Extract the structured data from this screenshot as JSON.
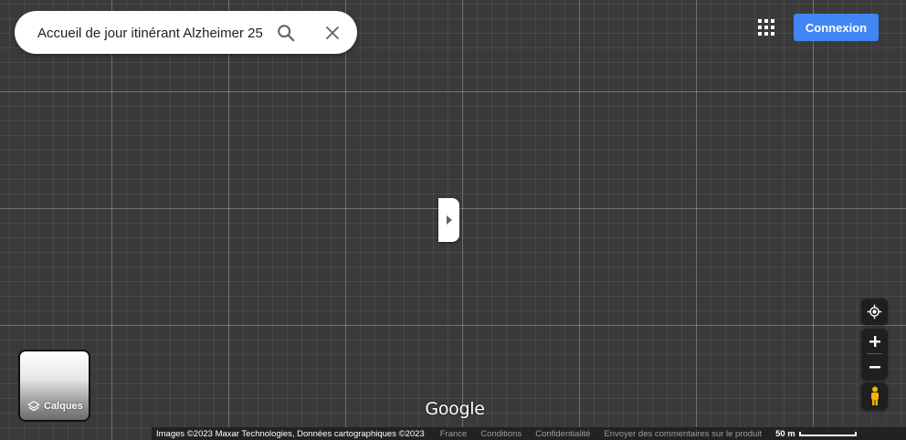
{
  "search": {
    "value": "Accueil de jour itinérant Alzheimer 25",
    "search_icon": "search-icon",
    "clear_icon": "close-icon"
  },
  "header": {
    "apps_icon": "apps-grid-icon",
    "signin_label": "Connexion"
  },
  "side_panel": {
    "toggle_icon": "caret-right-icon"
  },
  "layers": {
    "label": "Calques",
    "icon": "layers-icon"
  },
  "controls": {
    "locate_icon": "my-location-icon",
    "zoom_in_icon": "plus-icon",
    "zoom_out_icon": "minus-icon",
    "pegman_icon": "pegman-icon"
  },
  "logo": "Google",
  "attribution": {
    "imagery": "Images ©2023 Maxar Technologies, Données cartographiques ©2023",
    "links": [
      "France",
      "Conditions",
      "Confidentialité",
      "Envoyer des commentaires sur le produit"
    ],
    "scale_label": "50 m"
  },
  "colors": {
    "map_background": "#3a3a3a",
    "signin_button": "#4285f4",
    "pegman": "#f4b400",
    "control_bg": "#1f1f1f"
  }
}
